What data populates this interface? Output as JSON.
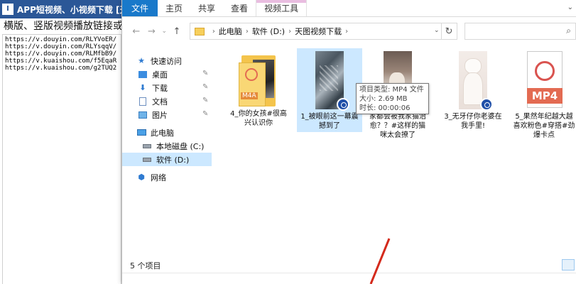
{
  "app": {
    "title": "APP短视频、小视频下载 [天图视频",
    "logo_glyph": "I",
    "heading": "横版、竖版视频播放链接或AF",
    "links": [
      "https://v.douyin.com/RLYVoER/",
      "https://v.douyin.com/RLYsqqV/",
      "https://v.douyin.com/RLMfbB9/",
      "https://v.kuaishou.com/f5EqaR",
      "https://v.kuaishou.com/g2TUQ2"
    ]
  },
  "explorer": {
    "ribbon_tabs": [
      "文件",
      "主页",
      "共享",
      "查看",
      "视频工具"
    ],
    "breadcrumbs": [
      "此电脑",
      "软件 (D:)",
      "天图视频下载"
    ],
    "nav": {
      "quick_access": "快速访问",
      "quick_items": [
        "桌面",
        "下载",
        "文档",
        "图片"
      ],
      "this_pc": "此电脑",
      "drives": [
        "本地磁盘 (C:)",
        "软件 (D:)"
      ],
      "network": "网络"
    },
    "files": [
      {
        "name": "4_你的女孩#很高兴认识你",
        "badge": "M4A"
      },
      {
        "name": "1_被眼前这一幕震撼到了"
      },
      {
        "name": "家都会被我家猫治愈？？#这样的猫咪太会撩了"
      },
      {
        "name": "3_无牙仔你老婆在我手里!"
      },
      {
        "name": "5_果然年纪越大越喜欢粉色#穿搭#劲爆卡点",
        "badge": "MP4"
      }
    ],
    "tooltip": {
      "type": "项目类型: MP4 文件",
      "size": "大小: 2.69 MB",
      "duration": "时长: 00:00:06"
    },
    "status": "5 个项目"
  },
  "colors": {
    "title_bar": "#2b5797",
    "file_tab": "#1979ca",
    "selection": "#cce8ff",
    "video_tools_accent": "#e9bde0",
    "arrow": "#d42a1c"
  },
  "icons": [
    "back-arrow-icon",
    "forward-arrow-icon",
    "up-arrow-icon",
    "refresh-icon",
    "search-icon",
    "folder-icon",
    "star-icon",
    "drive-icon",
    "network-icon",
    "video-badge-icon"
  ]
}
